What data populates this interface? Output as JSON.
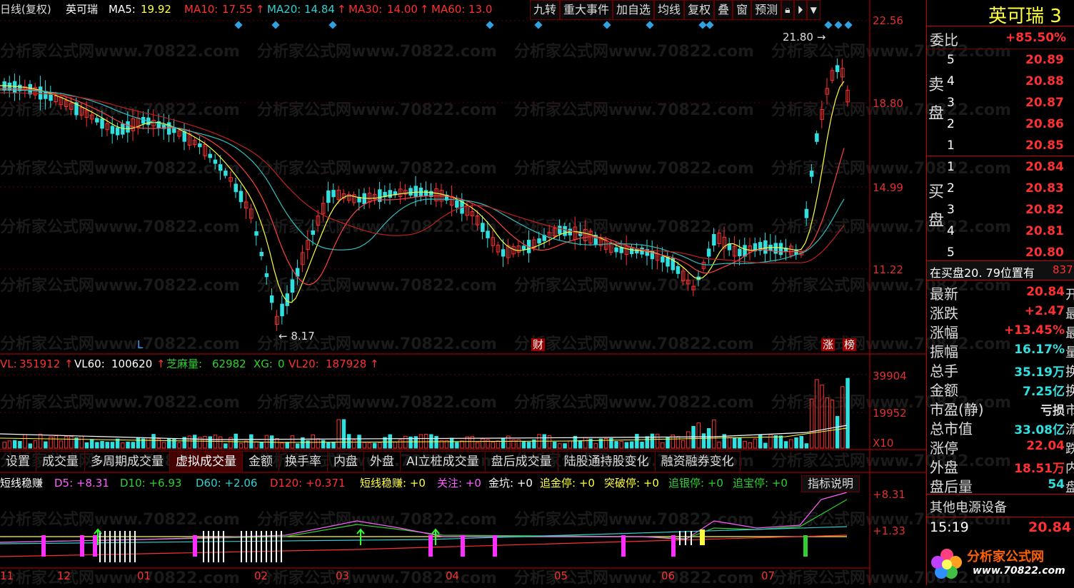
{
  "header": {
    "period": "日线(复权)",
    "stock": "英可瑞",
    "ma5_label": "MA5:",
    "ma5_value": "19.92",
    "ma10_label": "MA10:",
    "ma10_value": "17.55",
    "ma20_label": "MA20:",
    "ma20_value": "14.84",
    "ma30_label": "MA30:",
    "ma30_value": "14.00",
    "ma60_label": "MA60:",
    "ma60_value": "13.0",
    "arrow": "↑"
  },
  "toolbar": [
    "九转",
    "重大事件",
    "加自选",
    "均线",
    "复权",
    "叠",
    "窗",
    "预测"
  ],
  "price_axis": [
    "22.56",
    "18.80",
    "14.99",
    "11.22"
  ],
  "annotations": {
    "high": "21.80",
    "low": "8.17",
    "l_mark": "L",
    "cai": "财",
    "zhang": "涨",
    "bang": "榜"
  },
  "volume": {
    "vl_label": "VL:",
    "vl_value": "351912",
    "vl60_label": "VL60:",
    "vl60_value": "100620",
    "zm_label": "芝麻量:",
    "zm_value": "62982",
    "xg_label": "XG:",
    "xg_value": "0",
    "vl20_label": "VL20:",
    "vl20_value": "187928",
    "arrow": "↑",
    "axis": [
      "39904",
      "19952",
      "X10"
    ]
  },
  "tabs": [
    "设置",
    "成交量",
    "多周期成交量",
    "虚拟成交量",
    "金额",
    "换手率",
    "内盘",
    "外盘",
    "AI立桩成交量",
    "盘后成交量",
    "陆股通持股变化",
    "融资融券变化"
  ],
  "indicator": {
    "name": "短线稳赚",
    "d5": "D5: +8.31",
    "d10": "D10: +6.93",
    "d60": "D60: +2.06",
    "d120": "D120: +0.371",
    "s1": "短线稳赚: +0",
    "s2": "关注: +0",
    "s3": "金坑: +0",
    "s4": "追金停: +0",
    "s5": "突破停: +0",
    "s6": "追银停: +0",
    "s7": "追宝停: +0",
    "arrow": "↑",
    "button": "指标说明",
    "axis": [
      "+8.31",
      "+1.33"
    ]
  },
  "dates": [
    "11",
    "12",
    "01",
    "02",
    "03",
    "04",
    "05",
    "06",
    "07"
  ],
  "right_panel": {
    "title": "英可瑞 3",
    "weibi_label": "委比",
    "weibi_value": "+85.50%",
    "sell_label": "卖盘",
    "buy_label": "买盘",
    "sell": [
      {
        "n": "5",
        "p": "20.89"
      },
      {
        "n": "4",
        "p": "20.88"
      },
      {
        "n": "3",
        "p": "20.87"
      },
      {
        "n": "2",
        "p": "20.86"
      },
      {
        "n": "1",
        "p": "20.85"
      }
    ],
    "buy": [
      {
        "n": "1",
        "p": "20.84"
      },
      {
        "n": "2",
        "p": "20.83"
      },
      {
        "n": "3",
        "p": "20.82"
      },
      {
        "n": "4",
        "p": "20.81"
      },
      {
        "n": "5",
        "p": "20.80"
      }
    ],
    "notice": "在买盘20. 79位置有",
    "notice_num": "837",
    "stats": [
      {
        "k": "最新",
        "v": "20.84",
        "x": "开"
      },
      {
        "k": "涨跌",
        "v": "+2.47",
        "x": "最"
      },
      {
        "k": "涨幅",
        "v": "+13.45%",
        "x": "最"
      },
      {
        "k": "振幅",
        "v": "16.17%",
        "x": "量"
      },
      {
        "k": "总手",
        "v": "35.19万",
        "x": "换"
      },
      {
        "k": "金额",
        "v": "7.25亿",
        "x": "换"
      },
      {
        "k": "市盈(静)",
        "v": "亏损",
        "x": "市"
      },
      {
        "k": "总市值",
        "v": "33.08亿",
        "x": "流"
      },
      {
        "k": "涨停",
        "v": "22.04",
        "x": "跌"
      },
      {
        "k": "外盘",
        "v": "18.51万",
        "x": "内"
      },
      {
        "k": "盘后量",
        "v": "54",
        "x": "盘"
      }
    ],
    "device": "其他电源设备",
    "time": "15:19",
    "last": "20.84"
  },
  "logo": {
    "text": "分析家公式网",
    "url": "www.70822.com"
  },
  "watermark": "分析家公式网www.70822.com",
  "colors": {
    "up": "#ff3030",
    "down": "#30e0e0",
    "ma5": "#ffffff",
    "ma10": "#ffff40",
    "ma20": "#40d0d0",
    "ma30": "#ff60ff",
    "ma60": "#30d030",
    "axis": "#e03030"
  }
}
